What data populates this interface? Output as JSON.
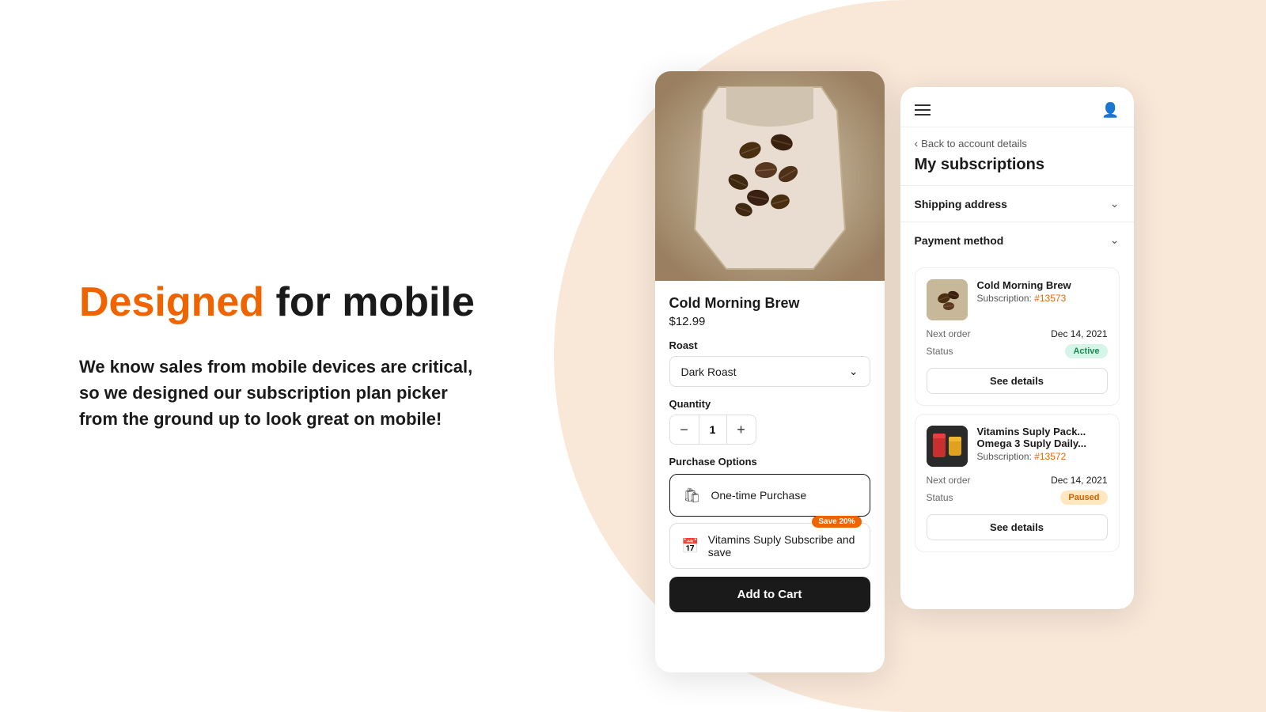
{
  "page": {
    "background_color": "#f9e8d8"
  },
  "hero": {
    "title_normal": "for mobile",
    "title_highlight": "Designed",
    "description": "We know sales from mobile devices are critical, so we designed our subscription plan picker from the ground up to look great on mobile!"
  },
  "product_card": {
    "image_alt": "Coffee beans in bag",
    "product_name": "Cold Morning Brew",
    "price": "$12.99",
    "roast_label": "Roast",
    "roast_value": "Dark Roast",
    "quantity_label": "Quantity",
    "quantity_value": "1",
    "purchase_options_label": "Purchase Options",
    "option_one_time": "One-time Purchase",
    "option_subscribe": "Vitamins Suply Subscribe and save",
    "save_badge": "Save 20%",
    "add_to_cart": "Add to Cart"
  },
  "subscriptions_card": {
    "back_label": "Back to account details",
    "page_title": "My subscriptions",
    "shipping_address_label": "Shipping address",
    "payment_method_label": "Payment method",
    "subscriptions": [
      {
        "name": "Cold Morning Brew",
        "subscription_id": "#13573",
        "subscription_prefix": "Subscription: ",
        "next_order_label": "Next order",
        "next_order_value": "Dec 14, 2021",
        "status_label": "Status",
        "status_value": "Active",
        "status_type": "active",
        "see_details": "See details",
        "image_type": "coffee"
      },
      {
        "name": "Vitamins Suply Pack...",
        "name_line2": "Omega 3 Suply Daily...",
        "subscription_id": "#13572",
        "subscription_prefix": "Subscription: ",
        "next_order_label": "Next order",
        "next_order_value": "Dec 14, 2021",
        "status_label": "Status",
        "status_value": "Paused",
        "status_type": "paused",
        "see_details": "See details",
        "image_type": "vitamins"
      }
    ]
  }
}
